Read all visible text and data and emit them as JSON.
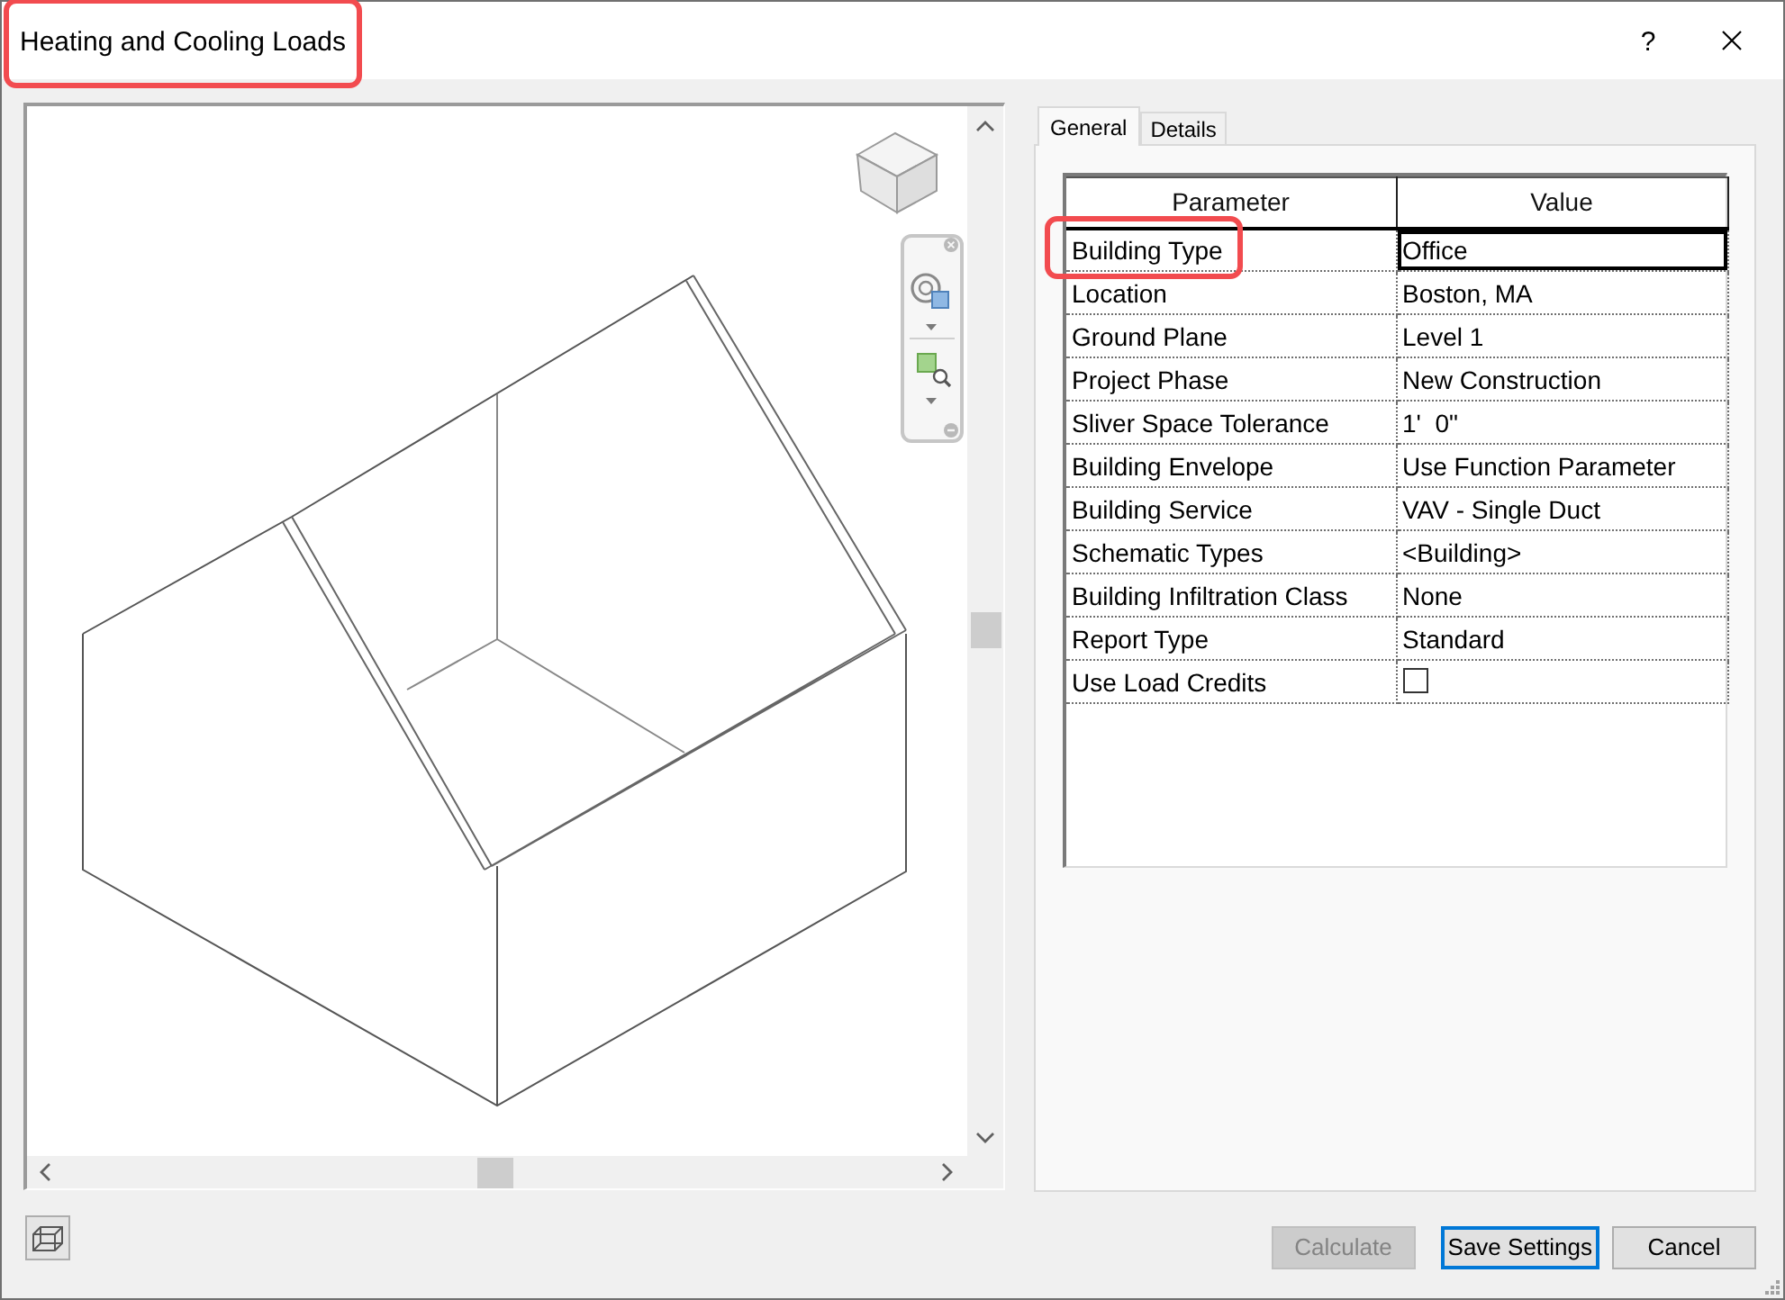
{
  "window": {
    "title": "Heating and Cooling Loads",
    "title_highlighted": true,
    "help_label": "?"
  },
  "tabs": [
    {
      "label": "General",
      "selected": true
    },
    {
      "label": "Details",
      "selected": false
    }
  ],
  "table": {
    "columns": [
      "Parameter",
      "Value"
    ],
    "rows": [
      {
        "kind": "text",
        "parameter": "Building Type",
        "value": "Office",
        "selected": true,
        "highlighted": true
      },
      {
        "kind": "text",
        "parameter": "Location",
        "value": "Boston, MA",
        "selected": false,
        "highlighted": false
      },
      {
        "kind": "text",
        "parameter": "Ground Plane",
        "value": "Level 1",
        "selected": false,
        "highlighted": false
      },
      {
        "kind": "text",
        "parameter": "Project Phase",
        "value": "New Construction",
        "selected": false,
        "highlighted": false
      },
      {
        "kind": "text",
        "parameter": "Sliver Space Tolerance",
        "value": "1'  0\"",
        "selected": false,
        "highlighted": false
      },
      {
        "kind": "text",
        "parameter": "Building Envelope",
        "value": "Use Function Parameter",
        "selected": false,
        "highlighted": false
      },
      {
        "kind": "text",
        "parameter": "Building Service",
        "value": "VAV - Single Duct",
        "selected": false,
        "highlighted": false
      },
      {
        "kind": "text",
        "parameter": "Schematic Types",
        "value": "<Building>",
        "selected": false,
        "highlighted": false
      },
      {
        "kind": "text",
        "parameter": "Building Infiltration Class",
        "value": "None",
        "selected": false,
        "highlighted": false
      },
      {
        "kind": "text",
        "parameter": "Report Type",
        "value": "Standard",
        "selected": false,
        "highlighted": false
      },
      {
        "kind": "checkbox",
        "parameter": "Use Load Credits",
        "checked": false,
        "selected": false,
        "highlighted": false
      }
    ]
  },
  "buttons": [
    {
      "label": "Calculate",
      "disabled": true,
      "focused": false
    },
    {
      "label": "Save Settings",
      "disabled": false,
      "focused": true
    },
    {
      "label": "Cancel",
      "disabled": false,
      "focused": false
    }
  ]
}
